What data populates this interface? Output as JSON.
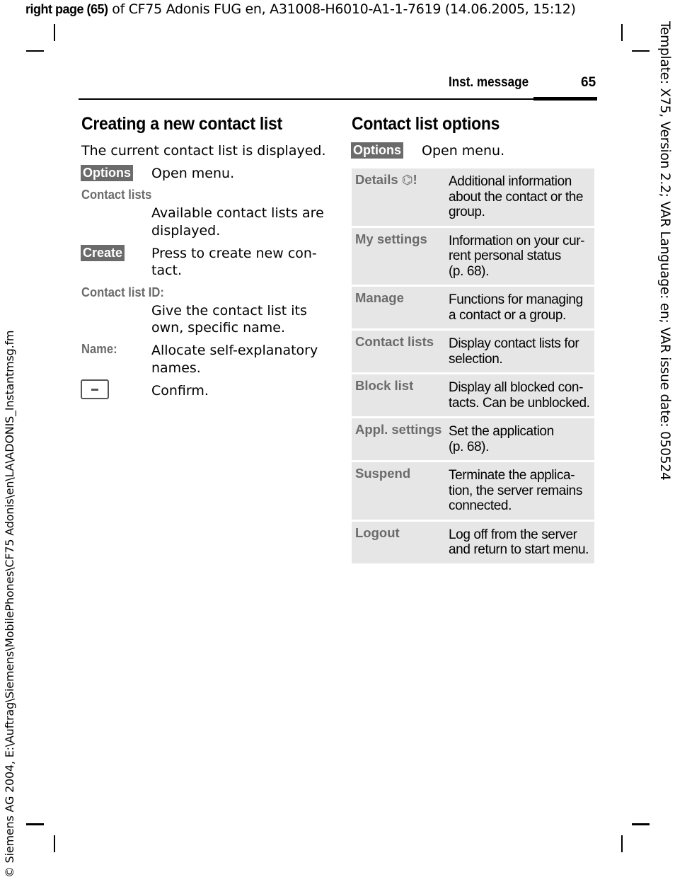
{
  "banner": {
    "bold": "right page (65)",
    "rest": " of CF75 Adonis FUG en, A31008-H6010-A1-1-7619 (14.06.2005, 15:12)"
  },
  "side_left": "© Siemens AG 2004, E:\\Auftrag\\Siemens\\MobilePhones\\CF75 Adonis\\en\\LA\\ADONIS_Instantmsg.fm",
  "side_right": "Template: X75, Version 2.2; VAR Language: en; VAR issue date: 050524",
  "header": {
    "section": "Inst. message",
    "page": "65"
  },
  "left": {
    "title": "Creating a new contact list",
    "intro": "The current contact list is displayed.",
    "steps": [
      {
        "key": "Options",
        "text": "Open menu."
      },
      {
        "label": "Contact lists",
        "text1": "Available contact lists are",
        "text2": "displayed."
      },
      {
        "key": "Create",
        "text1": "Press to create new con-",
        "text2": "tact."
      },
      {
        "label": "Contact list ID:",
        "text1": "Give the contact list its",
        "text2": "own, specific name."
      },
      {
        "label": "Name:",
        "text1": "Allocate self-explanatory",
        "text2": "names."
      },
      {
        "icon": "minus-key-icon",
        "text": "Confirm."
      }
    ]
  },
  "right": {
    "title": "Contact list options",
    "key": "Options",
    "key_text": "Open menu.",
    "options": [
      {
        "name": "Details",
        "icon": "hexagon-alert-icon",
        "desc": "Additional information about the contact or the group."
      },
      {
        "name": "My settings",
        "desc": "Information on your cur-rent personal status (p. 68)."
      },
      {
        "name": "Manage",
        "desc": "Functions for managing a contact or a group."
      },
      {
        "name": "Contact lists",
        "desc": "Display contact lists for selection."
      },
      {
        "name": "Block list",
        "desc": "Display all blocked con-tacts. Can be unblocked."
      },
      {
        "name": "Appl. settings",
        "desc": "Set the application (p. 68)."
      },
      {
        "name": "Suspend",
        "desc": "Terminate the applica-tion, the server remains connected."
      },
      {
        "name": "Logout",
        "desc": "Log off from the server and return to start menu."
      }
    ],
    "options_lines": [
      [
        "Additional information",
        "about the contact or the",
        "group."
      ],
      [
        "Information on your cur-",
        "rent personal status",
        "(p. 68)."
      ],
      [
        "Functions for managing",
        "a contact or a group."
      ],
      [
        "Display contact lists for",
        "selection."
      ],
      [
        "Display all blocked con-",
        "tacts. Can be unblocked."
      ],
      [
        "Set the application",
        "(p. 68)."
      ],
      [
        "Terminate the applica-",
        "tion, the server remains",
        "connected."
      ],
      [
        "Log off from the server",
        "and return to start menu."
      ]
    ]
  }
}
